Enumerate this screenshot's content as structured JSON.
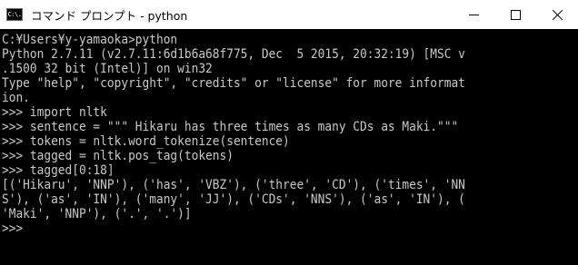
{
  "window": {
    "title": "コマンド プロンプト - python",
    "icon": "command-prompt-icon",
    "icon_text": "C:\\.",
    "controls": [
      {
        "name": "minimize-button",
        "icon": "minimize-icon"
      },
      {
        "name": "maximize-button",
        "icon": "maximize-icon"
      },
      {
        "name": "close-button",
        "icon": "close-icon"
      }
    ]
  },
  "console": {
    "lines": [
      "C:¥Users¥y-yamaoka>python",
      "Python 2.7.11 (v2.7.11:6d1b6a68f775, Dec  5 2015, 20:32:19) [MSC v",
      ".1500 32 bit (Intel)] on win32",
      "Type \"help\", \"copyright\", \"credits\" or \"license\" for more informat",
      "ion.",
      ">>> import nltk",
      ">>> sentence = \"\"\" Hikaru has three times as many CDs as Maki.\"\"\"",
      ">>> tokens = nltk.word_tokenize(sentence)",
      ">>> tagged = nltk.pos_tag(tokens)",
      ">>> tagged[0:18]",
      "[('Hikaru', 'NNP'), ('has', 'VBZ'), ('three', 'CD'), ('times', 'NN",
      "S'), ('as', 'IN'), ('many', 'JJ'), ('CDs', 'NNS'), ('as', 'IN'), (",
      "'Maki', 'NNP'), ('.', '.')]",
      ">>>"
    ]
  },
  "colors": {
    "background": "#000000",
    "foreground": "#c8c8c8",
    "titlebar": "#ffffff"
  }
}
